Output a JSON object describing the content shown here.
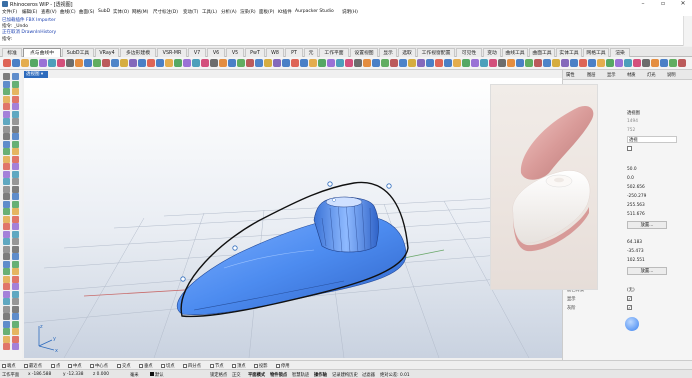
{
  "window": {
    "title": "Rhinoceros WIP - [透视图]"
  },
  "menu": [
    "文件(F)",
    "编辑(E)",
    "查看(V)",
    "曲线(C)",
    "曲面(S)",
    "SubD",
    "实体(O)",
    "网格(M)",
    "尺寸标注(D)",
    "变动(T)",
    "工具(L)",
    "分析(A)",
    "渲染(R)",
    "面板(P)",
    "Kt插件",
    "Aurpacker Studio",
    "说明(H)"
  ],
  "command_history": {
    "line1": "已加载插件 FBX Importer",
    "line2": "指令: _Undo",
    "line3": "正在取消 DrawnInHistory",
    "prompt": "指令:"
  },
  "tabs": [
    {
      "label": "标准",
      "active": false
    },
    {
      "label": "点与曲线中",
      "active": true
    },
    {
      "label": "SubD工具",
      "active": false
    },
    {
      "label": "VRay4",
      "active": false
    },
    {
      "label": "多边形建模",
      "active": false
    },
    {
      "label": "VSR-MR",
      "active": false
    },
    {
      "label": "V7",
      "active": false
    },
    {
      "label": "V6",
      "active": false
    },
    {
      "label": "V5",
      "active": false
    },
    {
      "label": "PwT",
      "active": false
    },
    {
      "label": "W8",
      "active": false
    },
    {
      "label": "PT",
      "active": false
    },
    {
      "label": "元",
      "active": false
    },
    {
      "label": "工作平面",
      "active": false
    },
    {
      "label": "设置视图",
      "active": false
    },
    {
      "label": "显示",
      "active": false
    },
    {
      "label": "选取",
      "active": false
    },
    {
      "label": "工作视窗配置",
      "active": false
    },
    {
      "label": "可见性",
      "active": false
    },
    {
      "label": "变动",
      "active": false
    },
    {
      "label": "曲线工具",
      "active": false
    },
    {
      "label": "曲面工具",
      "active": false
    },
    {
      "label": "实体工具",
      "active": false
    },
    {
      "label": "网格工具",
      "active": false
    },
    {
      "label": "渲染",
      "active": false
    }
  ],
  "viewport": {
    "label": "透视图",
    "axis_x": "x",
    "axis_y": "y",
    "axis_z": "z"
  },
  "right_panel": {
    "tabs": [
      "属性",
      "图层",
      "显示",
      "材质",
      "灯光",
      "说明"
    ],
    "rows": {
      "view_name": "透视图",
      "width": "1494",
      "height": "752",
      "projection": "透视",
      "cam_x": "50.0",
      "cam_y": "0.0",
      "cam_z": "502.656",
      "tgt_x": "-250.279",
      "tgt_y": "255.563",
      "tgt_z": "511.676",
      "place_button": "放置...",
      "v1": "64.183",
      "v2": "-35.473",
      "v3": "102.551",
      "place_button2": "放置...",
      "bg_label": "底色背景",
      "bg_value": "(无)",
      "show_label": "显示",
      "gray_label": "灰阶"
    }
  },
  "osnap": [
    {
      "label": "端点",
      "checked": true
    },
    {
      "label": "最近点",
      "checked": true
    },
    {
      "label": "点",
      "checked": true
    },
    {
      "label": "中点",
      "checked": true
    },
    {
      "label": "中心点",
      "checked": true
    },
    {
      "label": "交点",
      "checked": false
    },
    {
      "label": "垂点",
      "checked": false
    },
    {
      "label": "切点",
      "checked": false
    },
    {
      "label": "四分点",
      "checked": true
    },
    {
      "label": "节点",
      "checked": false
    },
    {
      "label": "顶点",
      "checked": false
    },
    {
      "label": "投影",
      "checked": false
    },
    {
      "label": "停用",
      "checked": false
    }
  ],
  "status": {
    "cplane": "工作平面",
    "x": "x -186.588",
    "y": "y -12.338",
    "z": "z 0.000",
    "unit": "毫米",
    "layer": "默认",
    "grid_snap": "锁定格点",
    "ortho": "正交",
    "planar": "平面模式",
    "osnap": "物件锁点",
    "smart": "智慧轨迹",
    "gumball": "操作轴",
    "history": "记录建构历史",
    "filter": "过滤器",
    "tolerance": "绝对公差: 0.01"
  },
  "colors": {
    "accent_blue": "#2d6bbd",
    "shape_blue": "#4d8cf0",
    "grid_bg_top": "#ffffff",
    "grid_bg_bottom": "#cfd8e6"
  }
}
